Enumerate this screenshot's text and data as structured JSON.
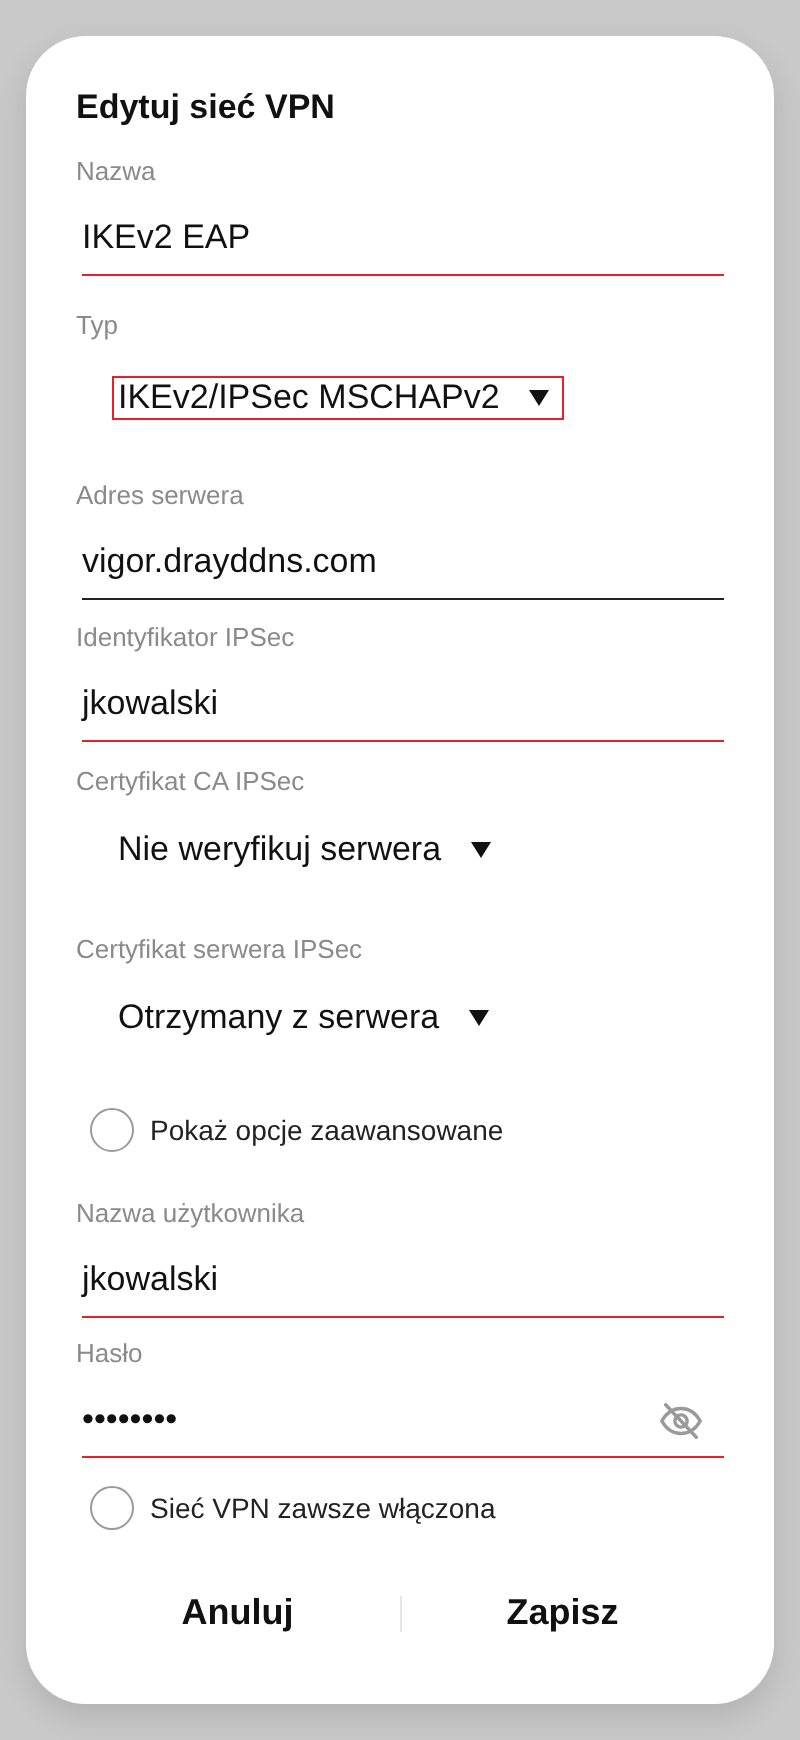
{
  "title": "Edytuj sieć VPN",
  "fields": [
    {
      "kind": "text",
      "label": "Nazwa",
      "value": "IKEv2 EAP",
      "highlighted": true
    },
    {
      "kind": "dropdown",
      "label": "Typ",
      "value": "IKEv2/IPSec MSCHAPv2",
      "highlighted": true
    },
    {
      "kind": "text",
      "label": "Adres serwera",
      "value": "vigor.drayddns.com",
      "highlighted": false
    },
    {
      "kind": "text",
      "label": "Identyfikator IPSec",
      "value": "jkowalski",
      "highlighted": true
    },
    {
      "kind": "dropdown",
      "label": "Certyfikat CA IPSec",
      "value": "Nie weryfikuj serwera",
      "highlighted": false
    },
    {
      "kind": "dropdown",
      "label": "Certyfikat serwera IPSec",
      "value": "Otrzymany z serwera",
      "highlighted": false
    },
    {
      "kind": "checkbox",
      "label": "Pokaż opcje zaawansowane",
      "checked": false
    },
    {
      "kind": "text",
      "label": "Nazwa użytkownika",
      "value": "jkowalski",
      "highlighted": true
    },
    {
      "kind": "password",
      "label": "Hasło",
      "value": "••••••••",
      "highlighted": true
    },
    {
      "kind": "checkbox",
      "label": "Sieć VPN zawsze włączona",
      "checked": false
    }
  ],
  "buttons": [
    "Anuluj",
    "Zapisz"
  ]
}
